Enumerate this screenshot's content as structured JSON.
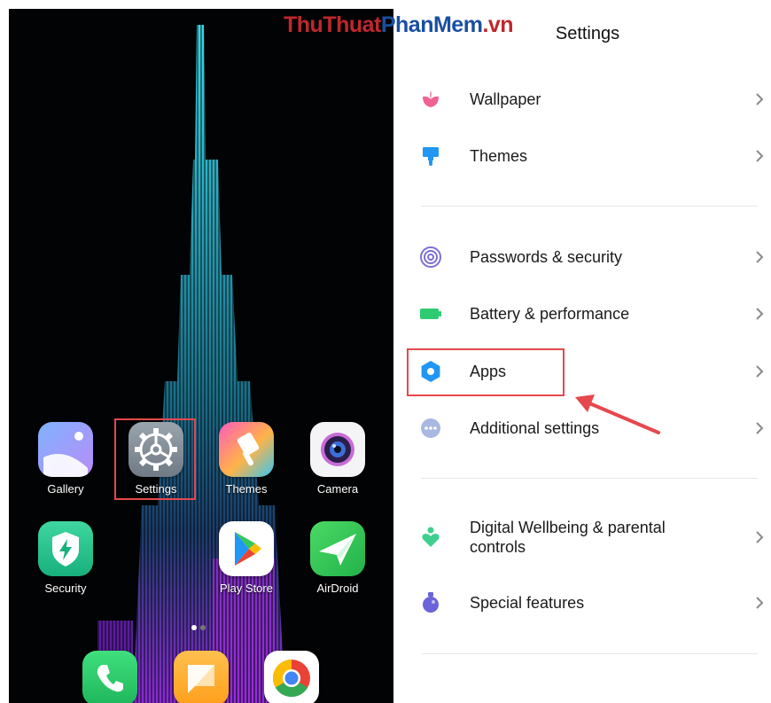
{
  "watermark": {
    "parts": [
      {
        "text": "ThuThuat",
        "color": "#c0272d"
      },
      {
        "text": "PhanMem",
        "color": "#1a4fa0"
      },
      {
        "text": ".vn",
        "color": "#c0272d"
      }
    ]
  },
  "home_screen": {
    "apps": [
      {
        "label": "Gallery",
        "icon": "gallery-icon"
      },
      {
        "label": "Settings",
        "icon": "gear-icon"
      },
      {
        "label": "Themes",
        "icon": "brush-icon"
      },
      {
        "label": "Camera",
        "icon": "camera-icon"
      },
      {
        "label": "Security",
        "icon": "shield-bolt-icon"
      },
      {
        "label": "Play Store",
        "icon": "play-store-icon"
      },
      {
        "label": "AirDroid",
        "icon": "paper-plane-icon"
      }
    ],
    "dock": [
      {
        "icon": "phone-icon"
      },
      {
        "icon": "messages-icon"
      },
      {
        "icon": "chrome-icon"
      }
    ],
    "page_indicator": {
      "pages": 2,
      "active": 1
    }
  },
  "settings": {
    "title": "Settings",
    "items": [
      {
        "label": "Wallpaper",
        "icon": "flower-icon",
        "icon_color": "#f06292"
      },
      {
        "label": "Themes",
        "icon": "paintbrush-icon",
        "icon_color": "#2196f3"
      },
      {
        "label": "Passwords & security",
        "icon": "fingerprint-icon",
        "icon_color": "#7c6fd6"
      },
      {
        "label": "Battery & performance",
        "icon": "battery-icon",
        "icon_color": "#2ecc71"
      },
      {
        "label": "Apps",
        "icon": "gear-icon",
        "icon_color": "#2196f3"
      },
      {
        "label": "Additional settings",
        "icon": "more-dots-icon",
        "icon_color": "#8ca0d0"
      },
      {
        "label": "Digital Wellbeing & parental controls",
        "icon": "wellbeing-icon",
        "icon_color": "#3ecf8e"
      },
      {
        "label": "Special features",
        "icon": "potion-icon",
        "icon_color": "#6b63d8"
      }
    ]
  },
  "annotation_color": "#e5484d"
}
